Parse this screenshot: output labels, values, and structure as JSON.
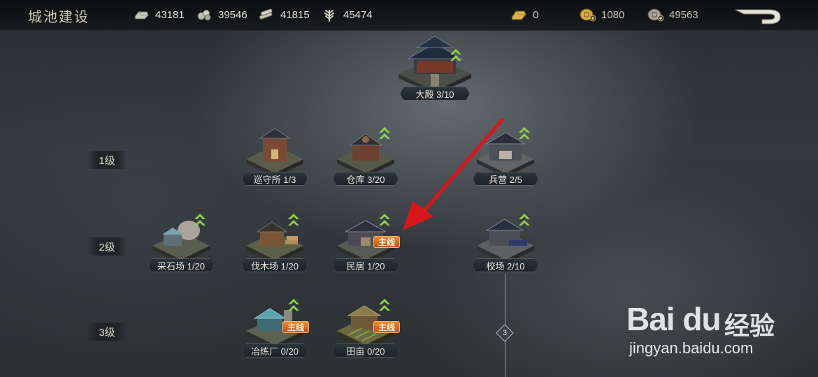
{
  "header": {
    "title": "城池建设",
    "resources": [
      {
        "icon": "silver-ingot-icon",
        "value": "43181"
      },
      {
        "icon": "stone-icon",
        "value": "39546"
      },
      {
        "icon": "wood-icon",
        "value": "41815"
      },
      {
        "icon": "grain-icon",
        "value": "45474"
      }
    ],
    "currencies": [
      {
        "icon": "gold-bar-icon",
        "value": "0"
      },
      {
        "icon": "gold-coin-plus-icon",
        "value": "1080"
      },
      {
        "icon": "copper-coin-plus-icon",
        "value": "49563"
      }
    ],
    "back_icon": "return-arrow-icon"
  },
  "tiers": [
    "1级",
    "2级",
    "3级"
  ],
  "palace": {
    "label": "大殿 3/10",
    "upgradable": true
  },
  "buildings": {
    "tier1": [
      {
        "label": "巡守所 1/3",
        "upgradable": false
      },
      {
        "label": "仓库 3/20",
        "upgradable": true
      },
      {
        "label": "兵营 2/5",
        "upgradable": true
      }
    ],
    "tier2": [
      {
        "label": "采石场 1/20",
        "upgradable": true
      },
      {
        "label": "伐木场 1/20",
        "upgradable": true
      },
      {
        "label": "民居 1/20",
        "upgradable": true,
        "tag": "主线"
      },
      {
        "label": "校场 2/10",
        "upgradable": true
      }
    ],
    "tier3": [
      {
        "label": "冶炼厂 0/20",
        "upgradable": true,
        "tag": "主线"
      },
      {
        "label": "田亩 0/20",
        "upgradable": true,
        "tag": "主线"
      }
    ]
  },
  "tree_node": "3",
  "watermark": {
    "logo": "Bai du",
    "cn": "经验",
    "url": "jingyan.baidu.com"
  },
  "colors": {
    "accent_tag": "#e0701f",
    "upgrade_arrow": "#8fd14a",
    "annotation_arrow": "#d8161b"
  }
}
